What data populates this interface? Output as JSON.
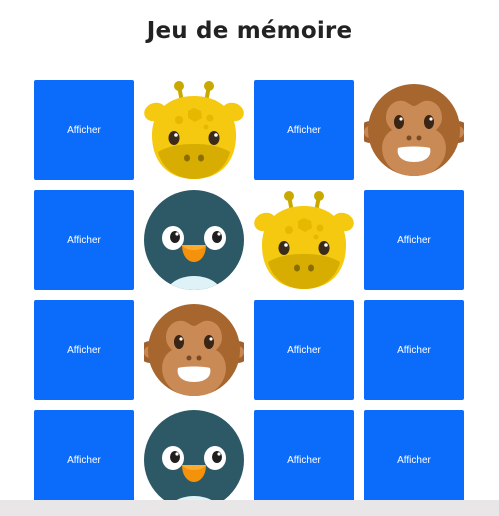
{
  "title": "Jeu de mémoire",
  "hidden_label": "Afficher",
  "colors": {
    "card_back": "#0b6bfb",
    "title_text": "#222222"
  },
  "cards": [
    {
      "state": "hidden"
    },
    {
      "state": "revealed",
      "animal": "giraffe"
    },
    {
      "state": "hidden"
    },
    {
      "state": "revealed",
      "animal": "monkey"
    },
    {
      "state": "hidden"
    },
    {
      "state": "revealed",
      "animal": "penguin"
    },
    {
      "state": "revealed",
      "animal": "giraffe"
    },
    {
      "state": "hidden"
    },
    {
      "state": "hidden"
    },
    {
      "state": "revealed",
      "animal": "monkey"
    },
    {
      "state": "hidden"
    },
    {
      "state": "hidden"
    },
    {
      "state": "hidden"
    },
    {
      "state": "revealed",
      "animal": "penguin"
    },
    {
      "state": "hidden"
    },
    {
      "state": "hidden"
    }
  ]
}
